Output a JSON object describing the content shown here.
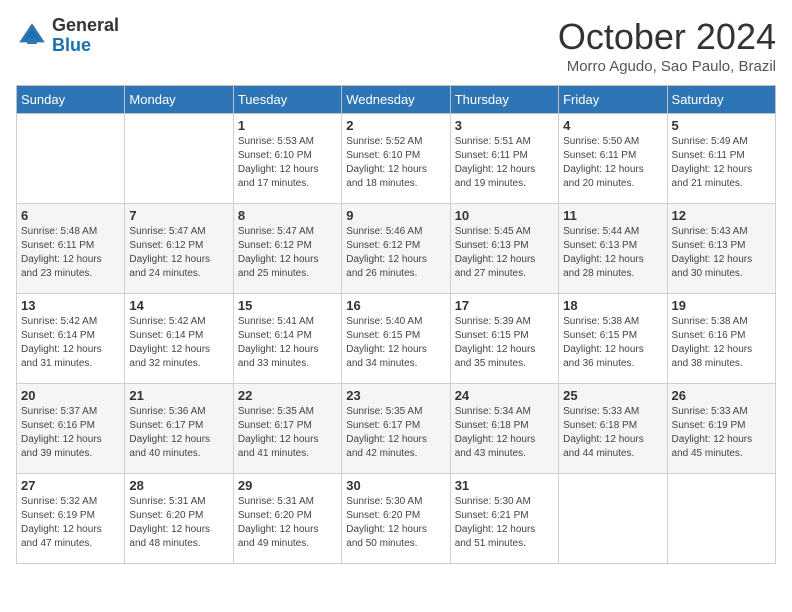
{
  "header": {
    "logo_general": "General",
    "logo_blue": "Blue",
    "month_title": "October 2024",
    "subtitle": "Morro Agudo, Sao Paulo, Brazil"
  },
  "weekdays": [
    "Sunday",
    "Monday",
    "Tuesday",
    "Wednesday",
    "Thursday",
    "Friday",
    "Saturday"
  ],
  "weeks": [
    [
      {
        "day": "",
        "info": ""
      },
      {
        "day": "",
        "info": ""
      },
      {
        "day": "1",
        "info": "Sunrise: 5:53 AM\nSunset: 6:10 PM\nDaylight: 12 hours and 17 minutes."
      },
      {
        "day": "2",
        "info": "Sunrise: 5:52 AM\nSunset: 6:10 PM\nDaylight: 12 hours and 18 minutes."
      },
      {
        "day": "3",
        "info": "Sunrise: 5:51 AM\nSunset: 6:11 PM\nDaylight: 12 hours and 19 minutes."
      },
      {
        "day": "4",
        "info": "Sunrise: 5:50 AM\nSunset: 6:11 PM\nDaylight: 12 hours and 20 minutes."
      },
      {
        "day": "5",
        "info": "Sunrise: 5:49 AM\nSunset: 6:11 PM\nDaylight: 12 hours and 21 minutes."
      }
    ],
    [
      {
        "day": "6",
        "info": "Sunrise: 5:48 AM\nSunset: 6:11 PM\nDaylight: 12 hours and 23 minutes."
      },
      {
        "day": "7",
        "info": "Sunrise: 5:47 AM\nSunset: 6:12 PM\nDaylight: 12 hours and 24 minutes."
      },
      {
        "day": "8",
        "info": "Sunrise: 5:47 AM\nSunset: 6:12 PM\nDaylight: 12 hours and 25 minutes."
      },
      {
        "day": "9",
        "info": "Sunrise: 5:46 AM\nSunset: 6:12 PM\nDaylight: 12 hours and 26 minutes."
      },
      {
        "day": "10",
        "info": "Sunrise: 5:45 AM\nSunset: 6:13 PM\nDaylight: 12 hours and 27 minutes."
      },
      {
        "day": "11",
        "info": "Sunrise: 5:44 AM\nSunset: 6:13 PM\nDaylight: 12 hours and 28 minutes."
      },
      {
        "day": "12",
        "info": "Sunrise: 5:43 AM\nSunset: 6:13 PM\nDaylight: 12 hours and 30 minutes."
      }
    ],
    [
      {
        "day": "13",
        "info": "Sunrise: 5:42 AM\nSunset: 6:14 PM\nDaylight: 12 hours and 31 minutes."
      },
      {
        "day": "14",
        "info": "Sunrise: 5:42 AM\nSunset: 6:14 PM\nDaylight: 12 hours and 32 minutes."
      },
      {
        "day": "15",
        "info": "Sunrise: 5:41 AM\nSunset: 6:14 PM\nDaylight: 12 hours and 33 minutes."
      },
      {
        "day": "16",
        "info": "Sunrise: 5:40 AM\nSunset: 6:15 PM\nDaylight: 12 hours and 34 minutes."
      },
      {
        "day": "17",
        "info": "Sunrise: 5:39 AM\nSunset: 6:15 PM\nDaylight: 12 hours and 35 minutes."
      },
      {
        "day": "18",
        "info": "Sunrise: 5:38 AM\nSunset: 6:15 PM\nDaylight: 12 hours and 36 minutes."
      },
      {
        "day": "19",
        "info": "Sunrise: 5:38 AM\nSunset: 6:16 PM\nDaylight: 12 hours and 38 minutes."
      }
    ],
    [
      {
        "day": "20",
        "info": "Sunrise: 5:37 AM\nSunset: 6:16 PM\nDaylight: 12 hours and 39 minutes."
      },
      {
        "day": "21",
        "info": "Sunrise: 5:36 AM\nSunset: 6:17 PM\nDaylight: 12 hours and 40 minutes."
      },
      {
        "day": "22",
        "info": "Sunrise: 5:35 AM\nSunset: 6:17 PM\nDaylight: 12 hours and 41 minutes."
      },
      {
        "day": "23",
        "info": "Sunrise: 5:35 AM\nSunset: 6:17 PM\nDaylight: 12 hours and 42 minutes."
      },
      {
        "day": "24",
        "info": "Sunrise: 5:34 AM\nSunset: 6:18 PM\nDaylight: 12 hours and 43 minutes."
      },
      {
        "day": "25",
        "info": "Sunrise: 5:33 AM\nSunset: 6:18 PM\nDaylight: 12 hours and 44 minutes."
      },
      {
        "day": "26",
        "info": "Sunrise: 5:33 AM\nSunset: 6:19 PM\nDaylight: 12 hours and 45 minutes."
      }
    ],
    [
      {
        "day": "27",
        "info": "Sunrise: 5:32 AM\nSunset: 6:19 PM\nDaylight: 12 hours and 47 minutes."
      },
      {
        "day": "28",
        "info": "Sunrise: 5:31 AM\nSunset: 6:20 PM\nDaylight: 12 hours and 48 minutes."
      },
      {
        "day": "29",
        "info": "Sunrise: 5:31 AM\nSunset: 6:20 PM\nDaylight: 12 hours and 49 minutes."
      },
      {
        "day": "30",
        "info": "Sunrise: 5:30 AM\nSunset: 6:20 PM\nDaylight: 12 hours and 50 minutes."
      },
      {
        "day": "31",
        "info": "Sunrise: 5:30 AM\nSunset: 6:21 PM\nDaylight: 12 hours and 51 minutes."
      },
      {
        "day": "",
        "info": ""
      },
      {
        "day": "",
        "info": ""
      }
    ]
  ]
}
